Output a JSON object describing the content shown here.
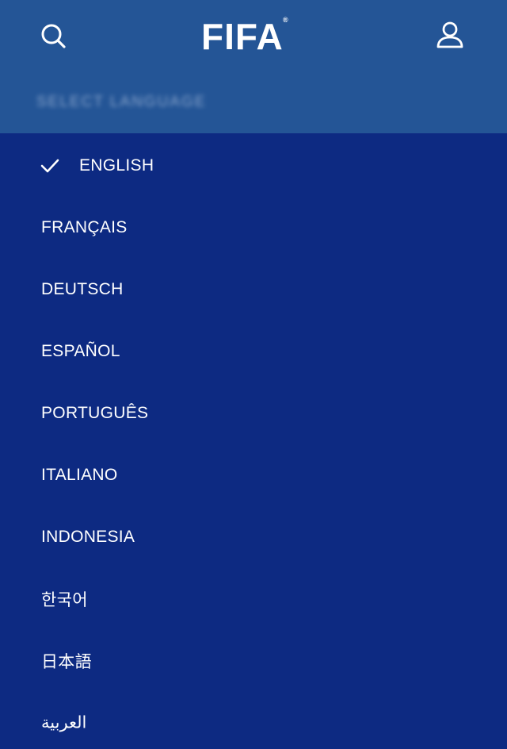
{
  "header": {
    "logo_text": "FIFA",
    "logo_mark": "®",
    "blurred_label": "SELECT LANGUAGE",
    "background": "#245596",
    "search_icon": "search-icon",
    "account_icon": "user-icon"
  },
  "language_menu": {
    "background": "#0d2a82",
    "selected": "ENGLISH",
    "items": [
      {
        "label": "ENGLISH"
      },
      {
        "label": "FRANÇAIS"
      },
      {
        "label": "DEUTSCH"
      },
      {
        "label": "ESPAÑOL"
      },
      {
        "label": "PORTUGUÊS"
      },
      {
        "label": "ITALIANO"
      },
      {
        "label": "INDONESIA"
      },
      {
        "label": "한국어"
      },
      {
        "label": "日本語"
      },
      {
        "label": "العربية"
      }
    ]
  }
}
